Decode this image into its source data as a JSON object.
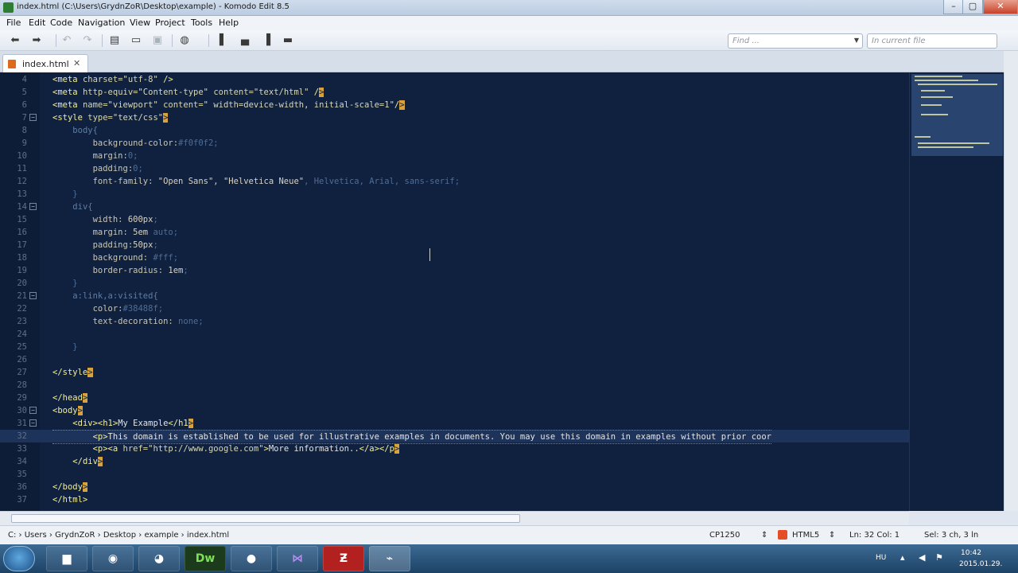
{
  "window": {
    "title": "index.html (C:\\Users\\GrydnZoR\\Desktop\\example) - Komodo Edit 8.5",
    "controls": [
      "–",
      "▢",
      "✕"
    ]
  },
  "menu": [
    "File",
    "Edit",
    "Code",
    "Navigation",
    "View",
    "Project",
    "Tools",
    "Help"
  ],
  "search": {
    "find_placeholder": "Find ...",
    "scope_placeholder": "In current file"
  },
  "tabs": [
    {
      "label": "index.html",
      "close": "✕"
    }
  ],
  "editor": {
    "lines": [
      {
        "n": "4",
        "fold": "",
        "code": [
          [
            "tag",
            "<meta "
          ],
          [
            "attr",
            "charset="
          ],
          [
            "str",
            "\"utf-8\""
          ],
          [
            "tag",
            " />"
          ]
        ]
      },
      {
        "n": "5",
        "fold": "",
        "code": [
          [
            "tag",
            "<meta "
          ],
          [
            "attr",
            "http-equiv="
          ],
          [
            "str",
            "\"Content-type\""
          ],
          [
            "attr",
            " content="
          ],
          [
            "str",
            "\"text/html\""
          ],
          [
            "tag",
            " /"
          ],
          [
            "br",
            ">"
          ]
        ]
      },
      {
        "n": "6",
        "fold": "",
        "code": [
          [
            "tag",
            "<meta "
          ],
          [
            "attr",
            "name="
          ],
          [
            "str",
            "\"viewport\""
          ],
          [
            "attr",
            " content="
          ],
          [
            "str",
            "\" width=device-width, initial-scale=1\""
          ],
          [
            "tag",
            "/"
          ],
          [
            "br",
            ">"
          ]
        ]
      },
      {
        "n": "7",
        "fold": "−",
        "code": [
          [
            "tag",
            "<style "
          ],
          [
            "attr",
            "type="
          ],
          [
            "str",
            "\"text/css\""
          ],
          [
            "br",
            ">"
          ]
        ]
      },
      {
        "n": "8",
        "fold": "",
        "code": [
          [
            "sp",
            "    "
          ],
          [
            "sel",
            "body{"
          ]
        ]
      },
      {
        "n": "9",
        "fold": "",
        "code": [
          [
            "sp",
            "        "
          ],
          [
            "prop",
            "background-color:"
          ],
          [
            "mut",
            "#f0f0f2;"
          ]
        ]
      },
      {
        "n": "10",
        "fold": "",
        "code": [
          [
            "sp",
            "        "
          ],
          [
            "prop",
            "margin:"
          ],
          [
            "mut",
            "0;"
          ]
        ]
      },
      {
        "n": "11",
        "fold": "",
        "code": [
          [
            "sp",
            "        "
          ],
          [
            "prop",
            "padding:"
          ],
          [
            "mut",
            "0;"
          ]
        ]
      },
      {
        "n": "12",
        "fold": "",
        "code": [
          [
            "sp",
            "        "
          ],
          [
            "prop",
            "font-family: "
          ],
          [
            "val",
            "\"Open Sans\", \"Helvetica Neue\""
          ],
          [
            "mut",
            ", Helvetica, Arial, sans-serif;"
          ]
        ]
      },
      {
        "n": "13",
        "fold": "",
        "code": [
          [
            "sp",
            "    "
          ],
          [
            "mut",
            "}"
          ]
        ]
      },
      {
        "n": "14",
        "fold": "−",
        "code": [
          [
            "sp",
            "    "
          ],
          [
            "sel",
            "div{"
          ]
        ]
      },
      {
        "n": "15",
        "fold": "",
        "code": [
          [
            "sp",
            "        "
          ],
          [
            "prop",
            "width: "
          ],
          [
            "val",
            "600px"
          ],
          [
            "mut",
            ";"
          ]
        ]
      },
      {
        "n": "16",
        "fold": "",
        "code": [
          [
            "sp",
            "        "
          ],
          [
            "prop",
            "margin: "
          ],
          [
            "val",
            "5em"
          ],
          [
            "mut",
            " auto;"
          ]
        ]
      },
      {
        "n": "17",
        "fold": "",
        "code": [
          [
            "sp",
            "        "
          ],
          [
            "prop",
            "padding:"
          ],
          [
            "val",
            "50px"
          ],
          [
            "mut",
            ";"
          ]
        ]
      },
      {
        "n": "18",
        "fold": "",
        "code": [
          [
            "sp",
            "        "
          ],
          [
            "prop",
            "background: "
          ],
          [
            "mut",
            "#fff;"
          ]
        ]
      },
      {
        "n": "19",
        "fold": "",
        "code": [
          [
            "sp",
            "        "
          ],
          [
            "prop",
            "border-radius: "
          ],
          [
            "val",
            "1em"
          ],
          [
            "mut",
            ";"
          ]
        ]
      },
      {
        "n": "20",
        "fold": "",
        "code": [
          [
            "sp",
            "    "
          ],
          [
            "mut",
            "}"
          ]
        ]
      },
      {
        "n": "21",
        "fold": "−",
        "code": [
          [
            "sp",
            "    "
          ],
          [
            "sel",
            "a:link,a:visited{"
          ]
        ]
      },
      {
        "n": "22",
        "fold": "",
        "code": [
          [
            "sp",
            "        "
          ],
          [
            "prop",
            "color:"
          ],
          [
            "mut",
            "#38488f;"
          ]
        ]
      },
      {
        "n": "23",
        "fold": "",
        "code": [
          [
            "sp",
            "        "
          ],
          [
            "prop",
            "text-decoration: "
          ],
          [
            "mut",
            "none;"
          ]
        ]
      },
      {
        "n": "24",
        "fold": "",
        "code": []
      },
      {
        "n": "25",
        "fold": "",
        "code": [
          [
            "sp",
            "    "
          ],
          [
            "mut",
            "}"
          ]
        ]
      },
      {
        "n": "26",
        "fold": "",
        "code": []
      },
      {
        "n": "27",
        "fold": "",
        "code": [
          [
            "tag",
            "</style"
          ],
          [
            "br",
            ">"
          ]
        ]
      },
      {
        "n": "28",
        "fold": "",
        "code": []
      },
      {
        "n": "29",
        "fold": "",
        "code": [
          [
            "tag",
            "</head"
          ],
          [
            "br",
            ">"
          ]
        ]
      },
      {
        "n": "30",
        "fold": "−",
        "code": [
          [
            "tag",
            "<body"
          ],
          [
            "br",
            ">"
          ]
        ]
      },
      {
        "n": "31",
        "fold": "−",
        "code": [
          [
            "sp",
            "    "
          ],
          [
            "tag",
            "<div><h1>"
          ],
          [
            "txt",
            "My Example"
          ],
          [
            "tag",
            "</h1"
          ],
          [
            "br",
            ">"
          ]
        ]
      },
      {
        "n": "32",
        "fold": "",
        "hl": true,
        "code": [
          [
            "sp",
            "        "
          ],
          [
            "tag",
            "<p>"
          ],
          [
            "txt",
            "This domain is established to be used for illustrative examples in documents. You may use this domain in examples without prior coor"
          ]
        ]
      },
      {
        "n": "33",
        "fold": "",
        "code": [
          [
            "sp",
            "        "
          ],
          [
            "tag",
            "<p><a "
          ],
          [
            "attr",
            "href="
          ],
          [
            "str",
            "\"http://www.google.com\""
          ],
          [
            "tag",
            ">"
          ],
          [
            "txt",
            "More information.."
          ],
          [
            "tag",
            "</a></p"
          ],
          [
            "br",
            ">"
          ]
        ]
      },
      {
        "n": "34",
        "fold": "",
        "code": [
          [
            "sp",
            "    "
          ],
          [
            "tag",
            "</div"
          ],
          [
            "br",
            ">"
          ]
        ]
      },
      {
        "n": "35",
        "fold": "",
        "code": []
      },
      {
        "n": "36",
        "fold": "",
        "code": [
          [
            "tag",
            "</body"
          ],
          [
            "br",
            ">"
          ]
        ]
      },
      {
        "n": "37",
        "fold": "",
        "code": [
          [
            "tag",
            "</html>"
          ]
        ]
      }
    ]
  },
  "statusbar": {
    "breadcrumb": [
      "C:",
      "Users",
      "GrydnZoR",
      "Desktop",
      "example",
      "index.html"
    ],
    "encoding": "CP1250",
    "language": "HTML5",
    "position": "Ln: 32 Col: 1",
    "selection": "Sel: 3 ch, 3 ln"
  },
  "taskbar": {
    "apps": [
      "folder",
      "chrome",
      "firefox",
      "Dw",
      "obs",
      "visual-studio",
      "filezilla",
      "komodo"
    ],
    "dw_label": "Dw",
    "lang": "HU",
    "time": "10:42",
    "date": "2015.01.29."
  },
  "colors": {
    "editor_bg": "#10213f",
    "tag": "#f2ee9a",
    "muted": "#4f6d96",
    "taskbar": "#2a5379"
  }
}
